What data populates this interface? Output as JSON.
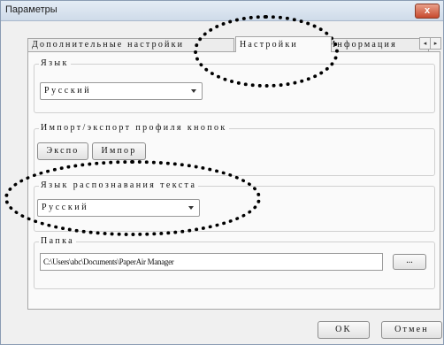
{
  "window": {
    "title": "Параметры",
    "close_symbol": "x"
  },
  "tabs": [
    {
      "label": "Дополнительные настройки",
      "active": false
    },
    {
      "label": "Настройки",
      "active": true
    },
    {
      "label": "Информация",
      "active": false
    }
  ],
  "tab_scroll": {
    "left_symbol": "◂",
    "right_symbol": "▸"
  },
  "language_group": {
    "label": "Язык",
    "selected": "Русский"
  },
  "import_export_group": {
    "label": "Импорт/экспорт профиля кнопок",
    "export_label": "Экспо",
    "import_label": "Импор"
  },
  "ocr_group": {
    "label": "Язык распознавания текста",
    "selected": "Русский"
  },
  "folder_group": {
    "label": "Папка",
    "path": "C:\\Users\\abc\\Documents\\PaperAir Manager",
    "browse_label": "..."
  },
  "footer": {
    "ok_label": "OK",
    "cancel_label": "Отмен"
  },
  "colors": {
    "annotation_oval": "#000000",
    "title_bar": "#cfdbe9",
    "close_button": "#c74a2e"
  }
}
